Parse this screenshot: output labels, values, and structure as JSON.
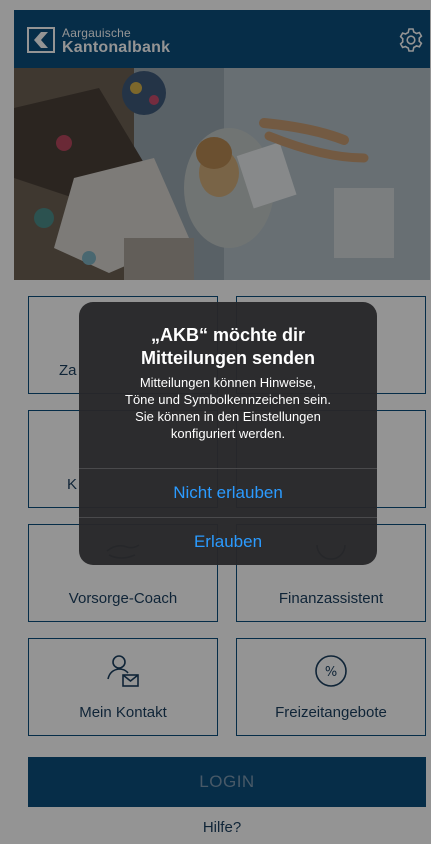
{
  "header": {
    "brand_line1": "Aargauische",
    "brand_line2": "Kantonalbank",
    "logo_icon": "akb-logo",
    "settings_icon": "gear-icon",
    "bar_color": "#0b4e7d"
  },
  "hero": {
    "icon": "artist-painting-photo"
  },
  "tiles": {
    "tile1_label": "Za",
    "tile2_label": "",
    "tile3_label": "K",
    "tile4_label": "",
    "vorsorge": {
      "label": "Vorsorge-Coach",
      "icon": "piggy-hand-icon"
    },
    "finanz": {
      "label": "Finanzassistent",
      "icon": "chart-circle-icon"
    },
    "kontakt": {
      "label": "Mein Kontakt",
      "icon": "person-mail-icon"
    },
    "freizeit": {
      "label": "Freizeitangebote",
      "icon": "percent-icon"
    }
  },
  "login_label": "LOGIN",
  "help_label": "Hilfe?",
  "dialog": {
    "title_line1": "„AKB“ möchte dir",
    "title_line2": "Mitteilungen senden",
    "message_line1": "Mitteilungen können Hinweise,",
    "message_line2": "Töne und Symbolkennzeichen sein.",
    "message_line3": "Sie können in den Einstellungen",
    "message_line4": "konfiguriert werden.",
    "deny_label": "Nicht erlauben",
    "allow_label": "Erlauben",
    "button_color": "#2b9bff"
  }
}
